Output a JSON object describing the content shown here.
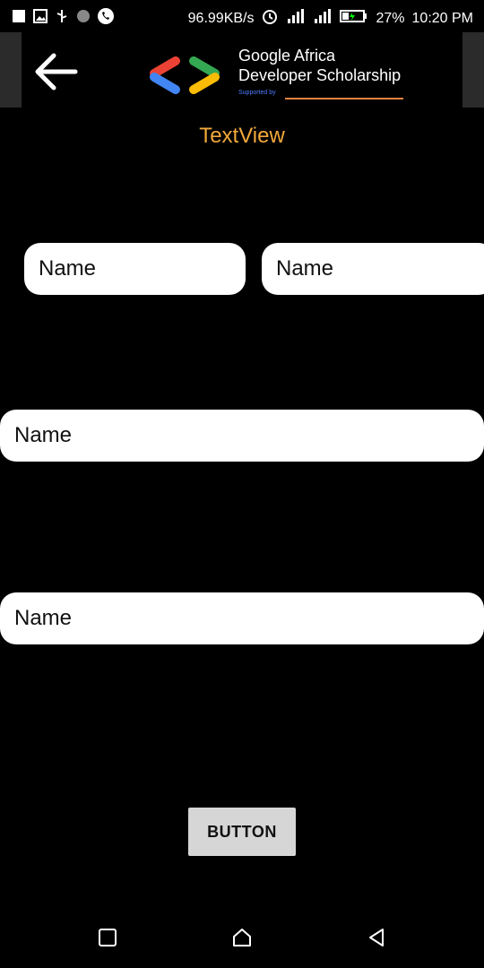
{
  "status_bar": {
    "net_speed": "96.99KB/s",
    "battery": "27%",
    "time": "10:20 PM",
    "icons": [
      "notification-square-icon",
      "image-icon",
      "usb-icon",
      "circle-icon",
      "phone-icon",
      "alarm-icon",
      "signal-icon",
      "signal-icon",
      "battery-icon"
    ]
  },
  "app_bar": {
    "logo_line1": "Google Africa",
    "logo_line2": "Developer Scholarship",
    "logo_supported": "Supported by"
  },
  "title": "TextView",
  "fields": {
    "row1_left_placeholder": "Name",
    "row1_right_placeholder": "Name",
    "middle_placeholder": "Name",
    "bottom_placeholder": "Name"
  },
  "button_label": "BUTTON",
  "colors": {
    "background": "#000000",
    "title": "#F2A93B",
    "field_bg": "#FFFFFF",
    "button_bg": "#D6D6D6"
  }
}
